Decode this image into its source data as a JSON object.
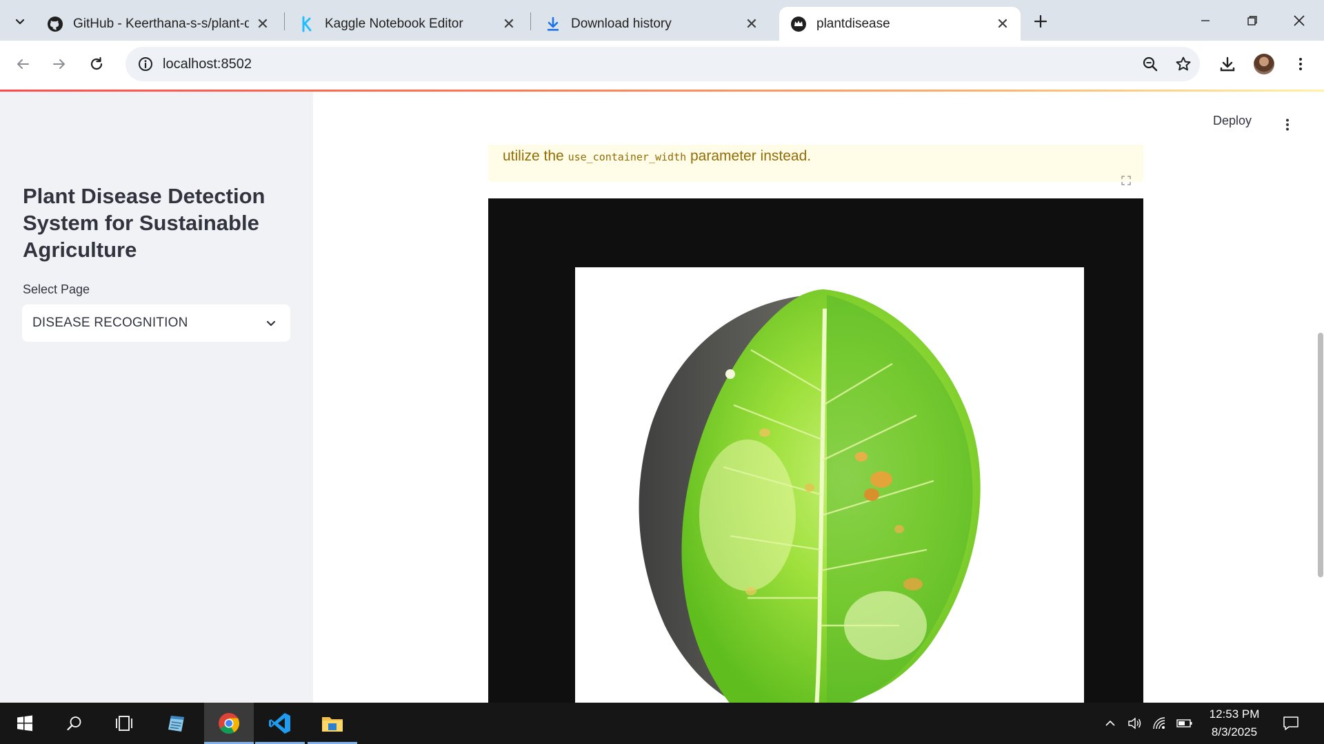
{
  "browser": {
    "tabs": [
      {
        "title": "GitHub - Keerthana-s-s/plant-d",
        "icon": "github-icon"
      },
      {
        "title": "Kaggle Notebook Editor",
        "icon": "kaggle-icon"
      },
      {
        "title": "Download history",
        "icon": "download-icon"
      },
      {
        "title": "plantdisease",
        "icon": "streamlit-crown-icon",
        "active": true
      }
    ],
    "url": "localhost:8502",
    "tab_close_glyph": "✕",
    "new_tab_glyph": "+"
  },
  "app": {
    "deploy_label": "Deploy",
    "sidebar": {
      "title": "Plant Disease Detection System for Sustainable Agriculture",
      "select_label": "Select Page",
      "select_value": "DISEASE RECOGNITION"
    },
    "warning": {
      "text_before": "utilize the ",
      "code": "use_container_width",
      "text_after": " parameter instead."
    },
    "image": {
      "subject": "leaf-image"
    }
  },
  "taskbar": {
    "time": "12:53 PM",
    "date": "8/3/2025"
  },
  "colors": {
    "accent": "#ff4b4b",
    "sidebar_bg": "#f0f2f6",
    "warning_bg": "#fffce7",
    "warning_text": "#926c05"
  }
}
